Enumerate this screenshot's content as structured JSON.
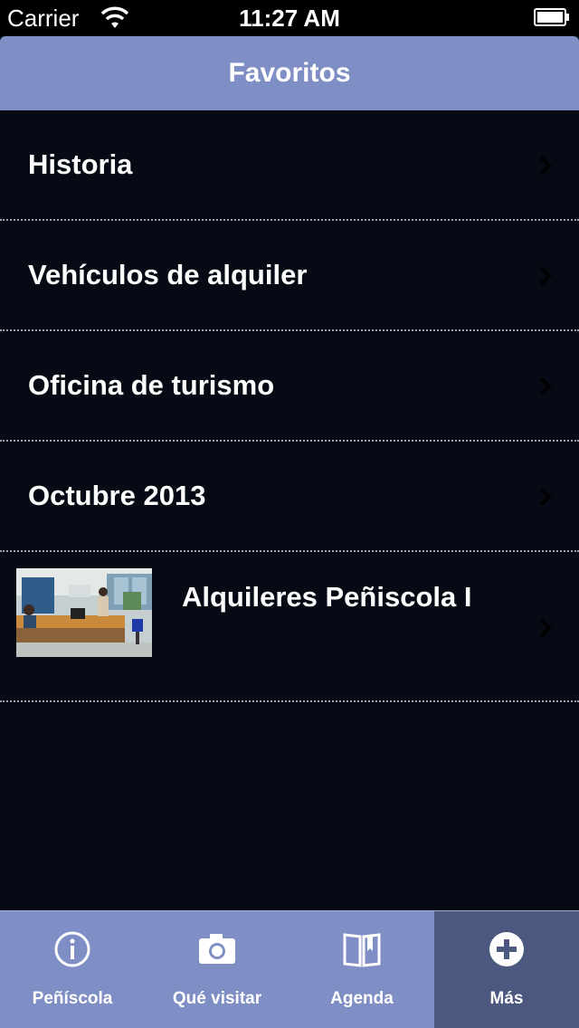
{
  "status_bar": {
    "carrier": "Carrier",
    "time": "11:27 AM",
    "wifi_icon": "wifi-icon",
    "battery_icon": "battery-icon"
  },
  "nav": {
    "title": "Favoritos"
  },
  "list": {
    "items": [
      {
        "label": "Historia"
      },
      {
        "label": "Vehículos de alquiler"
      },
      {
        "label": "Oficina de turismo"
      },
      {
        "label": "Octubre 2013"
      },
      {
        "label": "Alquileres Peñiscola I",
        "thumbnail": "office-photo"
      }
    ]
  },
  "tab_bar": {
    "tabs": [
      {
        "label": "Peñíscola",
        "icon": "info-icon"
      },
      {
        "label": "Qué visitar",
        "icon": "camera-icon"
      },
      {
        "label": "Agenda",
        "icon": "book-icon"
      },
      {
        "label": "Más",
        "icon": "plus-icon",
        "active": true
      }
    ]
  },
  "colors": {
    "nav_bar": "#7f8ec4",
    "background": "#050a14",
    "active_tab": "#4d5880"
  }
}
